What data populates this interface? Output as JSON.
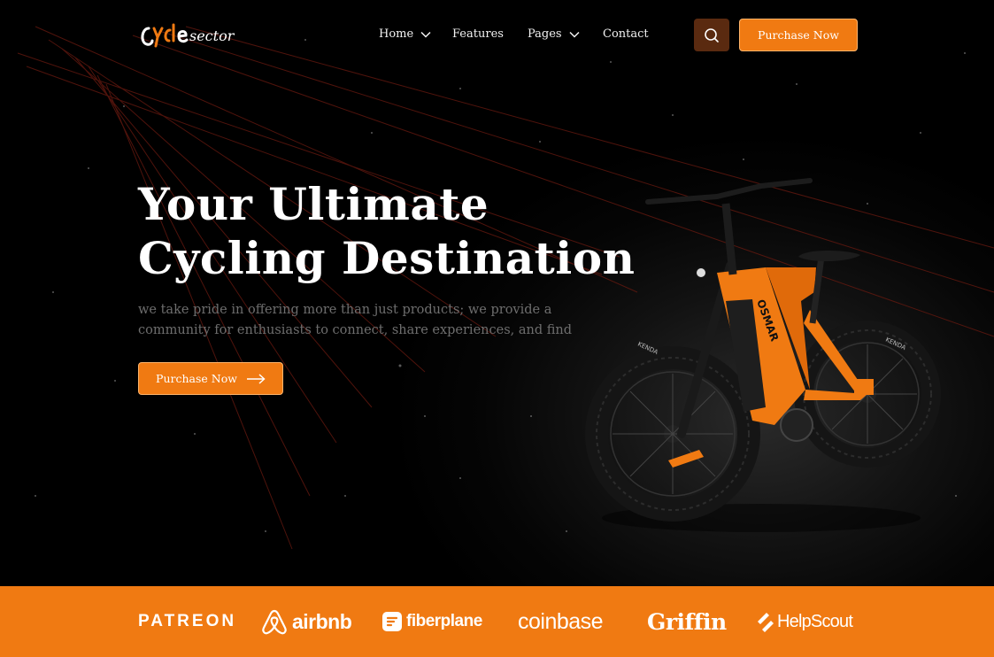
{
  "brand": {
    "logo_text_main": "cycle",
    "logo_text_script": "sector",
    "accent": "#f07a12"
  },
  "nav": {
    "items": [
      {
        "label": "Home",
        "has_dropdown": true
      },
      {
        "label": "Features",
        "has_dropdown": false
      },
      {
        "label": "Pages",
        "has_dropdown": true
      },
      {
        "label": "Contact",
        "has_dropdown": false
      }
    ],
    "search_icon": "search-icon",
    "purchase_label": "Purchase Now"
  },
  "hero": {
    "headline_line1": "Your Ultimate",
    "headline_line2": "Cycling Destination",
    "subtext_line1": "we take pride in offering more than just products; we provide a",
    "subtext_line2": "community for enthusiasts to connect, share experiences, and find",
    "cta_label": "Purchase Now",
    "cta_icon": "arrow-right-icon",
    "bike_frame_text": "OSMAR",
    "bike_tire_text": "KENDA"
  },
  "partners": {
    "logos": [
      "PATREON",
      "airbnb",
      "fiberplane",
      "coinbase",
      "Griffin",
      "HelpScout"
    ]
  }
}
